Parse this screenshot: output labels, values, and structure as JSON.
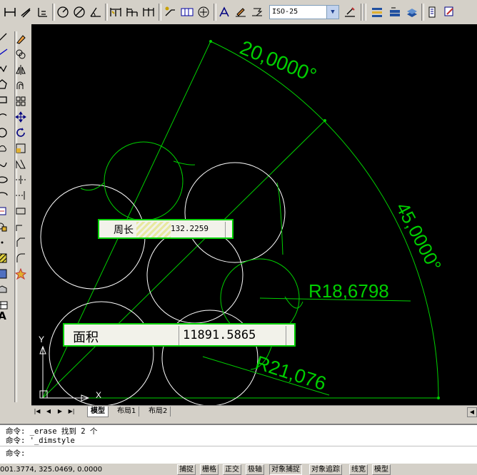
{
  "toolbar": {
    "dimstyle_value": "ISO-25",
    "icons": [
      "dim-linear-icon",
      "dim-aligned-icon",
      "dim-ordinate-icon",
      "dim-radius-icon",
      "dim-diameter-icon",
      "dim-angular-icon",
      "quick-dim-icon",
      "dim-baseline-icon",
      "dim-continue-icon",
      "leader-icon",
      "tolerance-icon",
      "center-mark-icon",
      "dim-edit-icon",
      "dim-text-edit-icon",
      "dim-update-icon",
      "dim-style-icon",
      "layer-icon",
      "layer-prev-icon",
      "layer-state-icon",
      "properties-icon",
      "match-properties-icon"
    ]
  },
  "left_toolbar": {
    "icons": [
      "line-icon",
      "construction-line-icon",
      "polyline-icon",
      "polygon-icon",
      "rectangle-icon",
      "arc-icon",
      "circle-icon",
      "cloud-icon",
      "spline-icon",
      "ellipse-icon",
      "ellipse-arc-icon",
      "insert-block-icon",
      "make-block-icon",
      "point-icon",
      "hatch-icon",
      "gradient-icon",
      "region-icon",
      "table-icon",
      "mtext-icon",
      "erase-icon",
      "copy-icon",
      "mirror-icon",
      "offset-icon",
      "array-icon",
      "move-icon",
      "rotate-icon",
      "scale-icon",
      "stretch-icon",
      "trim-icon",
      "extend-icon",
      "break-icon",
      "join-icon",
      "chamfer-icon",
      "fillet-icon",
      "explode-icon"
    ]
  },
  "drawing": {
    "dim_angle_top": "20,0000°",
    "dim_angle_right": "45,0000°",
    "dim_radius_1": "R18,6798",
    "dim_radius_2": "R21,076",
    "perimeter_label": "周长",
    "perimeter_value": "132.2259",
    "area_label": "面积",
    "area_value": "11891.5865",
    "ucs_x": "X",
    "ucs_y": "Y"
  },
  "tabs": {
    "items": [
      "模型",
      "布局1",
      "布局2"
    ],
    "active": "模型"
  },
  "command": {
    "lines": [
      "命令: _erase 找到 2 个",
      "命令: '_dimstyle",
      "命令:"
    ]
  },
  "status": {
    "coords": "001.3774, 325.0469, 0.0000",
    "buttons": [
      "捕捉",
      "栅格",
      "正交",
      "极轴",
      "对象捕捉",
      "对象追踪",
      "线宽",
      "模型"
    ]
  }
}
